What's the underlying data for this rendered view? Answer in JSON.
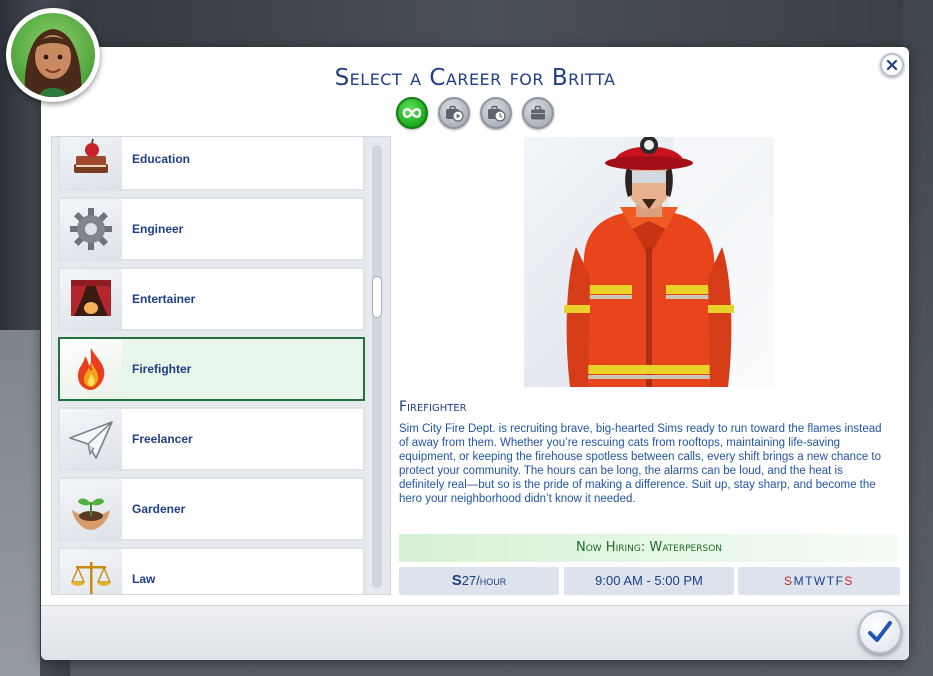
{
  "dialog": {
    "title": "Select a Career for Britta",
    "close_icon": "close-icon",
    "confirm_icon": "checkmark-icon"
  },
  "filters": [
    {
      "name": "all-careers-filter",
      "icon": "infinity-icon",
      "active": true
    },
    {
      "name": "part-time-filter",
      "icon": "briefcase-play-icon",
      "active": false
    },
    {
      "name": "freelance-filter",
      "icon": "briefcase-clock-icon",
      "active": false
    },
    {
      "name": "full-time-filter",
      "icon": "briefcase-icon",
      "active": false
    }
  ],
  "careers": [
    {
      "label": "Education",
      "icon": "books-apple-icon",
      "selected": false
    },
    {
      "label": "Engineer",
      "icon": "gear-icon",
      "selected": false
    },
    {
      "label": "Entertainer",
      "icon": "stage-curtain-icon",
      "selected": false
    },
    {
      "label": "Firefighter",
      "icon": "flame-icon",
      "selected": true
    },
    {
      "label": "Freelancer",
      "icon": "paper-plane-icon",
      "selected": false
    },
    {
      "label": "Gardener",
      "icon": "sprout-hands-icon",
      "selected": false
    },
    {
      "label": "Law",
      "icon": "scales-icon",
      "selected": false
    }
  ],
  "scroll": {
    "position": 0.32
  },
  "detail": {
    "name": "Firefighter",
    "description": "Sim City Fire Dept. is recruiting brave, big‑hearted Sims ready to run toward the flames instead of away from them. Whether you’re rescuing cats from rooftops, maintaining life‑saving equipment, or keeping the firehouse spotless between calls, every shift brings a new chance to protect your community. The hours can be long, the alarms can be loud, and the heat is definitely real—but so is the pride of making a difference. Suit up, stay sharp, and become the hero your neighborhood didn’t know it needed.",
    "hiring": "Now Hiring: Waterperson",
    "pay_symbol": "S",
    "pay_amount": "27",
    "pay_unit": "/hour",
    "hours": "9:00 AM - 5:00 PM",
    "days": [
      {
        "letter": "S",
        "off": true
      },
      {
        "letter": "M",
        "off": false
      },
      {
        "letter": "T",
        "off": false
      },
      {
        "letter": "W",
        "off": false
      },
      {
        "letter": "T",
        "off": false
      },
      {
        "letter": "F",
        "off": false
      },
      {
        "letter": "S",
        "off": true
      }
    ]
  },
  "colors": {
    "title_blue": "#1e3f87",
    "text_blue": "#2354a8",
    "hiring_green": "#1e6b2a",
    "selected_border": "#23703a",
    "day_off_red": "#c42828"
  }
}
